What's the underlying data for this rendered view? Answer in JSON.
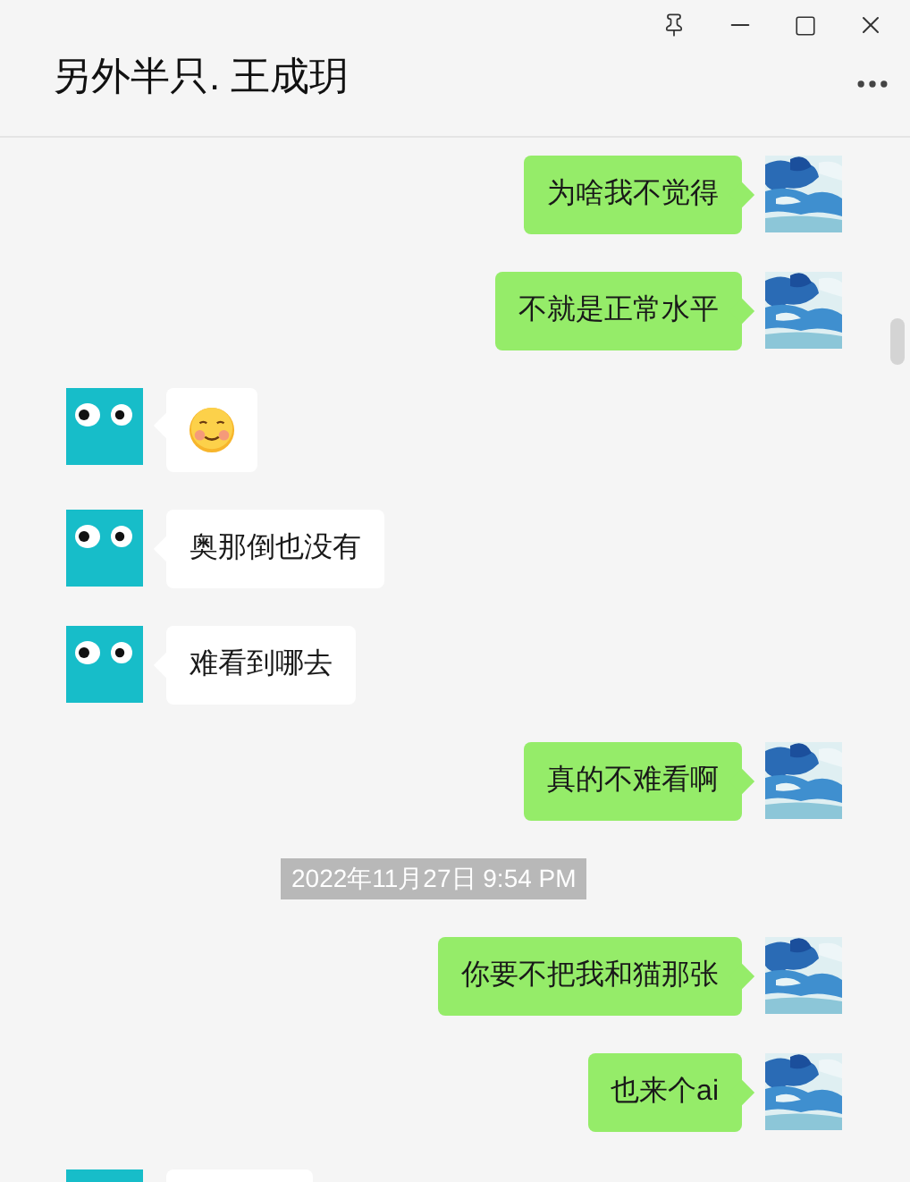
{
  "window": {
    "title": "另外半只. 王成玥"
  },
  "messages": [
    {
      "kind": "sent",
      "text": "为啥我不觉得"
    },
    {
      "kind": "sent",
      "text": "不就是正常水平"
    },
    {
      "kind": "sticker"
    },
    {
      "kind": "received",
      "text": "奥那倒也没有"
    },
    {
      "kind": "received",
      "text": "难看到哪去"
    },
    {
      "kind": "sent",
      "text": "真的不难看啊"
    },
    {
      "kind": "time",
      "text": "2022年11月27日 9:54 PM"
    },
    {
      "kind": "sent",
      "text": "你要不把我和猫那张"
    },
    {
      "kind": "sent",
      "text": "也来个ai"
    },
    {
      "kind": "cut"
    }
  ]
}
